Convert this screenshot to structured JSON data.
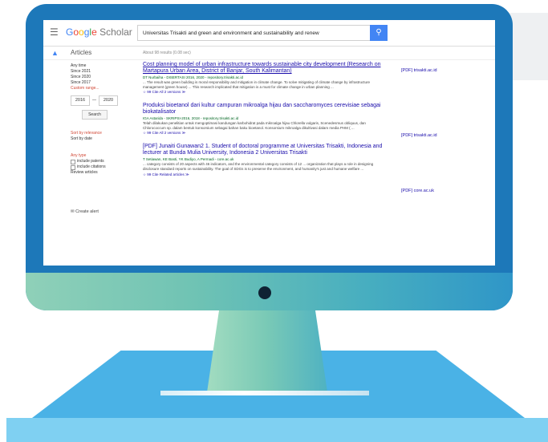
{
  "scholar": {
    "logo": {
      "g1": "G",
      "o1": "o",
      "o2": "o",
      "g2": "g",
      "l": "l",
      "e": "e",
      "rest": " Scholar"
    },
    "search_query": "Universitas Trisakti and green and environment and sustainability and renew",
    "search_icon": "search-icon",
    "articles_label": "Articles",
    "about": "About 98 results (0.08 sec)",
    "sidebar": {
      "time": [
        "Any time",
        "Since 2021",
        "Since 2020",
        "Since 2017"
      ],
      "custom_range": "Custom range...",
      "year_from": "2016",
      "year_to": "2020",
      "search_label": "Search",
      "sort_relevance": "Sort by relevance",
      "sort_date": "Sort by date",
      "any_type": "Any type",
      "include_patents": "include patents",
      "include_citations": "include citations",
      "review_articles": "Review articles",
      "create_alert": "Create alert"
    },
    "results": [
      {
        "title": "Cost planning model of urban infrastructure towards sustainable city development (Research on Martapura Urban Area, District of Banjar, South Kalimantan)",
        "meta": "DT Nurbaiha - DISERTASI 2016, 2020 - repository.trisakti.ac.id",
        "snippet": "... The result was green building is moral responsibility and mitigation in climate change. To solve mitigating of climate change by infrastructure management (green house) ... This research implicated that mitigation is a must for climate change in urban planning ...",
        "links": "☆  99 Cite   All 2 versions   ≫",
        "pdf": "[PDF] trisakti.ac.id"
      },
      {
        "title": "Produksi bioetanol dari kultur campuran mikroalga hijau dan saccharomyces cerevisiae sebagai biokatalisator",
        "meta": "IGA Astarida - SKRIPSI-2016, 2018 - repository.trisakti.ac.id",
        "snippet": "Telah dilakukan penelitian untuk mengoptimasi kandungan karbohidrat pada mikroalga hijau Chlorella vulgaris, Scenedesmus obliquus, dan Chlorococcum sp. dalam bentuk konsorsium sebagai bahan baku bioetanol. Konsorsium mikroalga dikultivasi dalam media PHM ( ...",
        "links": "☆  99 Cite   All 2 versions   ≫",
        "pdf": "[PDF] trisakti.ac.id"
      },
      {
        "title": "[PDF] Junaiti Gunawan2 1. Student of doctoral programme at Universitas Trisakti, Indonesia and lecturer at Bunda Mulia University, Indonesia 2 Universitas Trisakti",
        "meta": "T Setiawan, KE Basti, YK Budiyo, A Permadi - core.ac.uk",
        "snippet": "... category consists of 20 aspects with 46 indicators, and the environmental category consists of 12 ... organization that plays a role in designing disclosure standard reports on sustainability. The goal of SDGs is to preserve the environment, and humanity's just and humane welfare ...",
        "links": "☆  99 Cite   Related articles   ≫",
        "pdf": "[PDF] core.ac.uk"
      }
    ]
  },
  "colors": {
    "frame": "#1d78b9",
    "desk": "#4ab2e6",
    "accent": "#4285f4"
  }
}
